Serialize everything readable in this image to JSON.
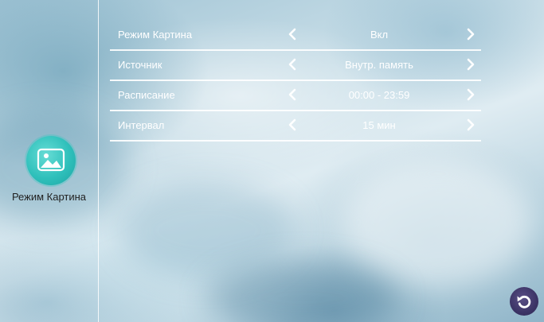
{
  "sidebar": {
    "app_icon": "picture-icon",
    "app_label": "Режим Картина"
  },
  "menu": {
    "rows": [
      {
        "label": "Режим Картина",
        "value": "Вкл"
      },
      {
        "label": "Источник",
        "value": "Внутр. память"
      },
      {
        "label": "Расписание",
        "value": "00:00 - 23:59"
      },
      {
        "label": "Интервал",
        "value": "15 мин"
      }
    ]
  },
  "footer": {
    "back_icon": "undo-icon"
  },
  "colors": {
    "accent_teal": "#2fc0bb",
    "back_button": "#3c3466",
    "text_light": "#ffffff",
    "text_dark": "#222222"
  }
}
